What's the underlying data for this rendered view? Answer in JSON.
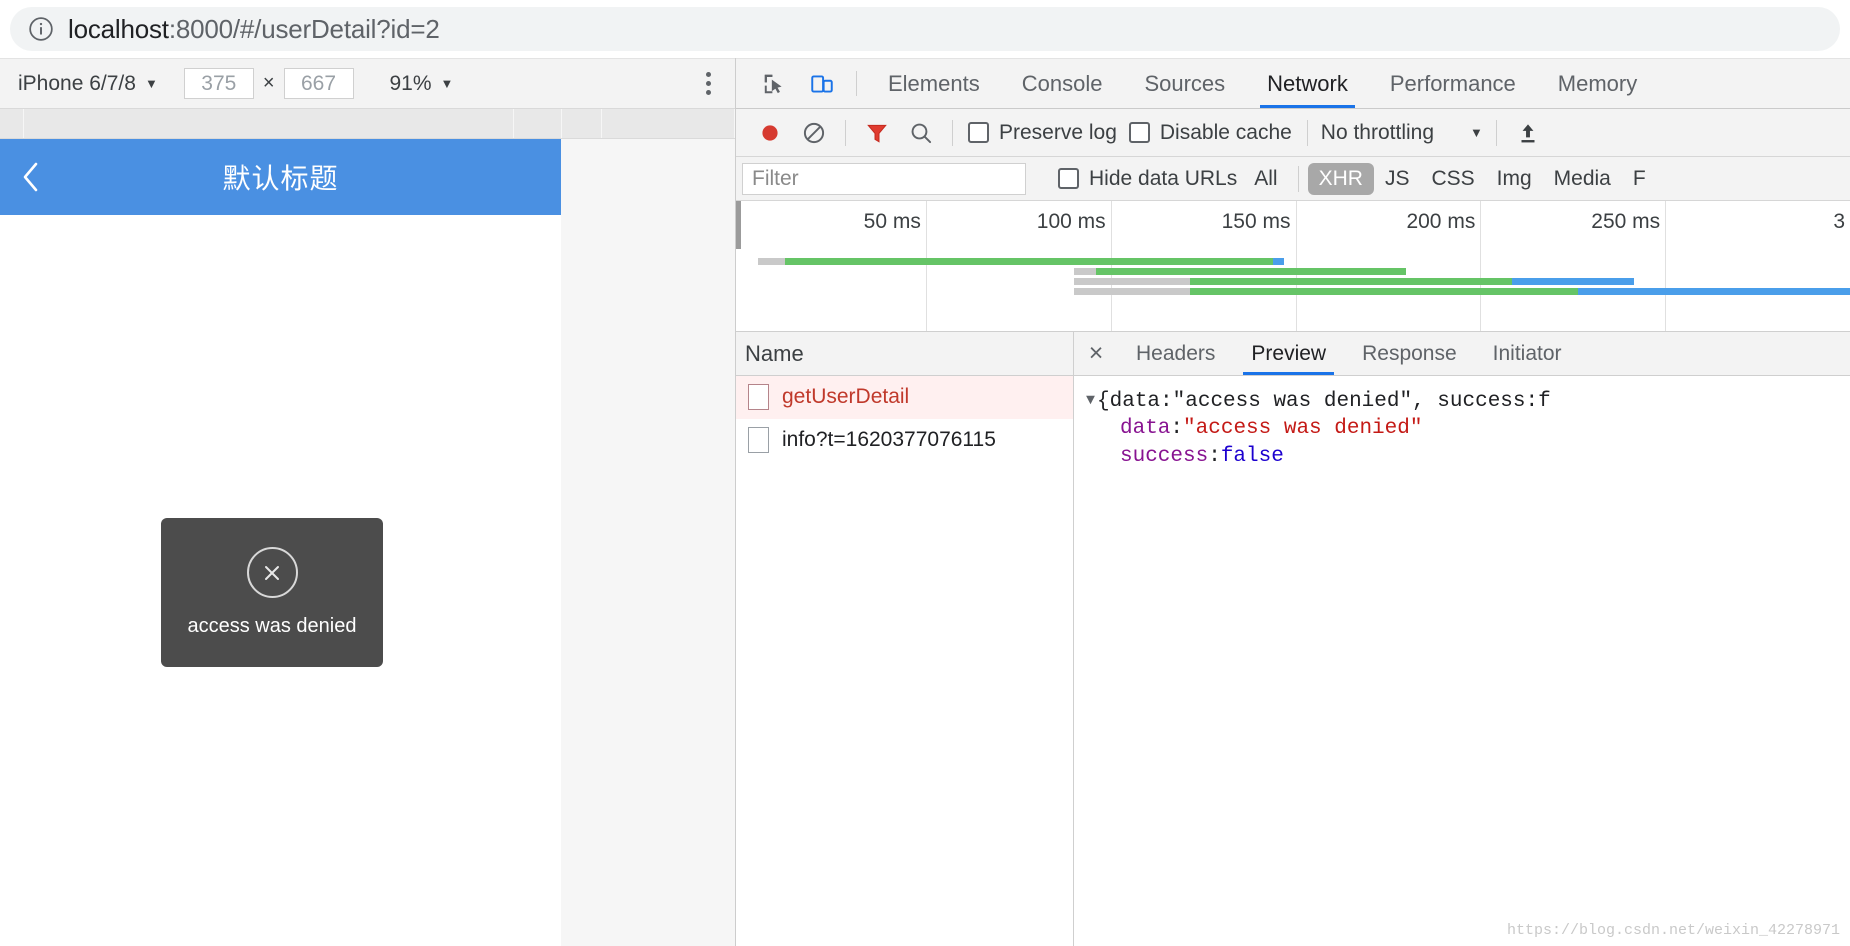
{
  "browser": {
    "info_icon": "info-circle-icon",
    "url_prefix": "localhost",
    "url_suffix": ":8000/#/userDetail?id=2",
    "url_full": "localhost:8000/#/userDetail?id=2"
  },
  "device_toolbar": {
    "device": "iPhone 6/7/8",
    "width": "375",
    "height": "667",
    "times": "×",
    "zoom": "91%",
    "caret": "▼",
    "more_icon": "kebab-menu-icon"
  },
  "viewport": {
    "back_icon": "back-chevron-icon",
    "title": "默认标题",
    "toast": {
      "icon": "circle-x-icon",
      "text": "access was denied"
    }
  },
  "devtools": {
    "inspect_icon": "inspect-element-icon",
    "device_icon": "toggle-device-toolbar-icon",
    "tabs": [
      {
        "label": "Elements",
        "active": false
      },
      {
        "label": "Console",
        "active": false
      },
      {
        "label": "Sources",
        "active": false
      },
      {
        "label": "Network",
        "active": true
      },
      {
        "label": "Performance",
        "active": false
      },
      {
        "label": "Memory",
        "active": false
      }
    ],
    "network_toolbar": {
      "record_icon": "record-button-icon",
      "clear_icon": "clear-network-log-icon",
      "filter_icon": "filter-funnel-icon",
      "search_icon": "search-icon",
      "preserve_log_label": "Preserve log",
      "disable_cache_label": "Disable cache",
      "throttling_label": "No throttling",
      "throttling_caret": "▼",
      "import_icon": "import-har-icon"
    },
    "filter_row": {
      "filter_placeholder": "Filter",
      "filter_value": "",
      "hide_data_urls_label": "Hide data URLs",
      "types": [
        {
          "label": "All",
          "active": false
        },
        {
          "label": "XHR",
          "active": true
        },
        {
          "label": "JS",
          "active": false
        },
        {
          "label": "CSS",
          "active": false
        },
        {
          "label": "Img",
          "active": false
        },
        {
          "label": "Media",
          "active": false
        },
        {
          "label": "F",
          "active": false
        }
      ]
    },
    "overview": {
      "ticks": [
        "50 ms",
        "100 ms",
        "150 ms",
        "200 ms",
        "250 ms",
        "3"
      ],
      "bars": [
        {
          "start_pct": 1.5,
          "wait_pct": 2.5,
          "green_pct": 44.0,
          "blue_pct": 1.0,
          "row": 0
        },
        {
          "start_pct": 30.0,
          "wait_pct": 2.0,
          "green_pct": 28.0,
          "blue_pct": 0.0,
          "row": 1
        },
        {
          "start_pct": 30.0,
          "wait_pct": 10.5,
          "green_pct": 29.0,
          "blue_pct": 11.0,
          "row": 2
        },
        {
          "start_pct": 30.0,
          "wait_pct": 10.5,
          "green_pct": 35.0,
          "blue_pct": 66.0,
          "row": 3
        }
      ],
      "color_wait": "#c9c9c9",
      "color_download": "#65c466",
      "color_wait2": "#4a9eea"
    },
    "requests": {
      "column_header": "Name",
      "rows": [
        {
          "name": "getUserDetail",
          "error": true,
          "selected": true,
          "icon": "document-icon"
        },
        {
          "name": "info?t=1620377076115",
          "error": false,
          "selected": false,
          "icon": "document-icon"
        }
      ]
    },
    "detail": {
      "close_icon": "×",
      "tabs": [
        {
          "label": "Headers",
          "active": false
        },
        {
          "label": "Preview",
          "active": true
        },
        {
          "label": "Response",
          "active": false
        },
        {
          "label": "Initiator",
          "active": false
        }
      ],
      "preview": {
        "disclosure": "▼",
        "summary_prefix": "{data: ",
        "summary_value": "\"access was denied\"",
        "summary_mid": ", success: ",
        "summary_bool": "f",
        "rows": [
          {
            "key": "data",
            "sep": ": ",
            "value": "\"access was denied\"",
            "kind": "string"
          },
          {
            "key": "success",
            "sep": ": ",
            "value": "false",
            "kind": "bool"
          }
        ]
      }
    }
  },
  "watermark": "https://blog.csdn.net/weixin_42278971"
}
